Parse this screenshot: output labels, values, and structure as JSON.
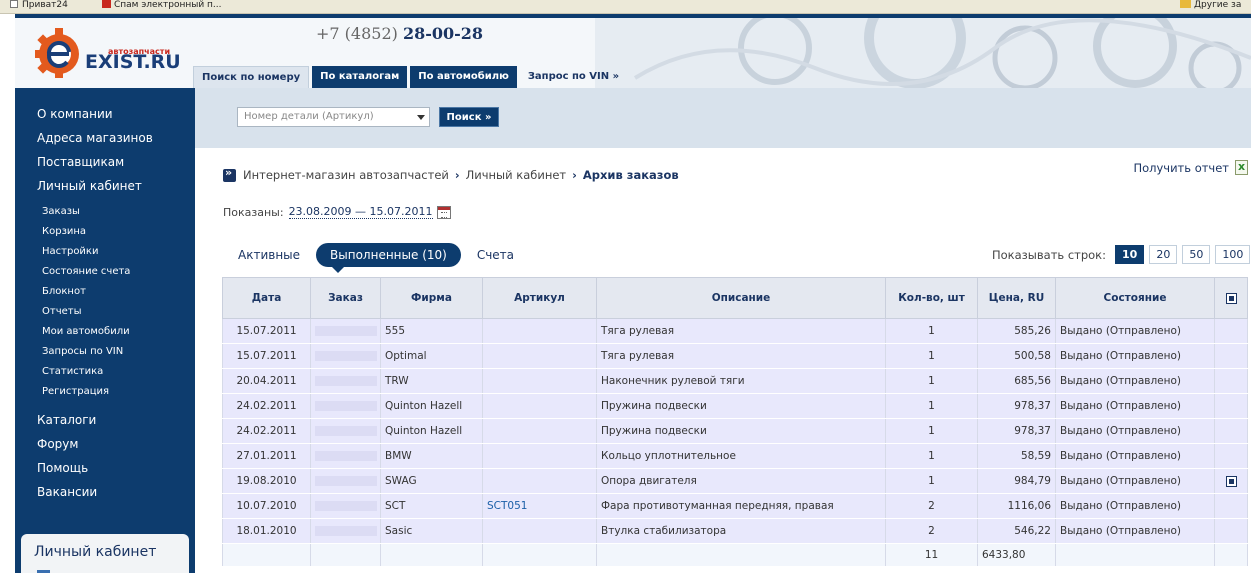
{
  "bookmarks": {
    "item1": "Приват24",
    "item2": "Спам электронный п...",
    "item3": "Другие за"
  },
  "logo": {
    "name": "EXIST.RU",
    "tagline": "автозапчасти"
  },
  "phone": {
    "code": "+7 (4852)",
    "number": "28-00-28"
  },
  "nav_tabs": [
    {
      "label": "Поиск по номеру"
    },
    {
      "label": "По каталогам"
    },
    {
      "label": "По автомобилю"
    },
    {
      "label": "Запрос по VIN »"
    }
  ],
  "search": {
    "placeholder": "Номер детали (Артикул)",
    "button": "Поиск »"
  },
  "sidebar": {
    "main": [
      {
        "label": "О компании"
      },
      {
        "label": "Адреса магазинов"
      },
      {
        "label": "Поставщикам"
      },
      {
        "label": "Личный кабинет"
      }
    ],
    "sub": [
      {
        "label": "Заказы"
      },
      {
        "label": "Корзина"
      },
      {
        "label": "Настройки"
      },
      {
        "label": "Состояние счета"
      },
      {
        "label": "Блокнот"
      },
      {
        "label": "Отчеты"
      },
      {
        "label": "Мои автомобили"
      },
      {
        "label": "Запросы по VIN"
      },
      {
        "label": "Статистика"
      },
      {
        "label": "Регистрация"
      }
    ],
    "bottom": [
      {
        "label": "Каталоги"
      },
      {
        "label": "Форум"
      },
      {
        "label": "Помощь"
      },
      {
        "label": "Вакансии"
      }
    ],
    "cabinet_box_title": "Личный кабинет"
  },
  "breadcrumbs": {
    "item1": "Интернет-магазин автозапчастей",
    "sep": "›",
    "item2": "Личный кабинет",
    "current": "Архив заказов"
  },
  "report_link": "Получить отчет",
  "shown": {
    "label": "Показаны:",
    "range": "23.08.2009 — 15.07.2011"
  },
  "subtabs": [
    {
      "label": "Активные"
    },
    {
      "label": "Выполненные (10)"
    },
    {
      "label": "Счета"
    }
  ],
  "rows_per_page": {
    "label": "Показывать строк:",
    "options": [
      "10",
      "20",
      "50",
      "100"
    ],
    "selected": "10"
  },
  "table": {
    "headers": [
      "Дата",
      "Заказ",
      "Фирма",
      "Артикул",
      "Описание",
      "Кол-во, шт",
      "Цена, RU",
      "Состояние"
    ],
    "rows": [
      {
        "date": "15.07.2011",
        "firm": "555",
        "article": "",
        "desc": "Тяга рулевая",
        "qty": "1",
        "price": "585,26",
        "status": "Выдано (Отправлено)"
      },
      {
        "date": "15.07.2011",
        "firm": "Optimal",
        "article": "",
        "desc": "Тяга рулевая",
        "qty": "1",
        "price": "500,58",
        "status": "Выдано (Отправлено)"
      },
      {
        "date": "20.04.2011",
        "firm": "TRW",
        "article": "",
        "desc": "Наконечник рулевой тяги",
        "qty": "1",
        "price": "685,56",
        "status": "Выдано (Отправлено)"
      },
      {
        "date": "24.02.2011",
        "firm": "Quinton Hazell",
        "article": "",
        "desc": "Пружина подвески",
        "qty": "1",
        "price": "978,37",
        "status": "Выдано (Отправлено)"
      },
      {
        "date": "24.02.2011",
        "firm": "Quinton Hazell",
        "article": "",
        "desc": "Пружина подвески",
        "qty": "1",
        "price": "978,37",
        "status": "Выдано (Отправлено)"
      },
      {
        "date": "27.01.2011",
        "firm": "BMW",
        "article": "",
        "desc": "Кольцо уплотнительное",
        "qty": "1",
        "price": "58,59",
        "status": "Выдано (Отправлено)"
      },
      {
        "date": "19.08.2010",
        "firm": "SWAG",
        "article": "",
        "desc": "Опора двигателя",
        "qty": "1",
        "price": "984,79",
        "status": "Выдано (Отправлено)"
      },
      {
        "date": "10.07.2010",
        "firm": "SCT",
        "article": "SCT051",
        "desc": "Фара противотуманная передняя, правая",
        "qty": "2",
        "price": "1116,06",
        "status": "Выдано (Отправлено)"
      },
      {
        "date": "18.01.2010",
        "firm": "Sasic",
        "article": "",
        "desc": "Втулка стабилизатора",
        "qty": "2",
        "price": "546,22",
        "status": "Выдано (Отправлено)"
      }
    ],
    "totals": {
      "qty": "11",
      "price": "6433,80"
    }
  }
}
